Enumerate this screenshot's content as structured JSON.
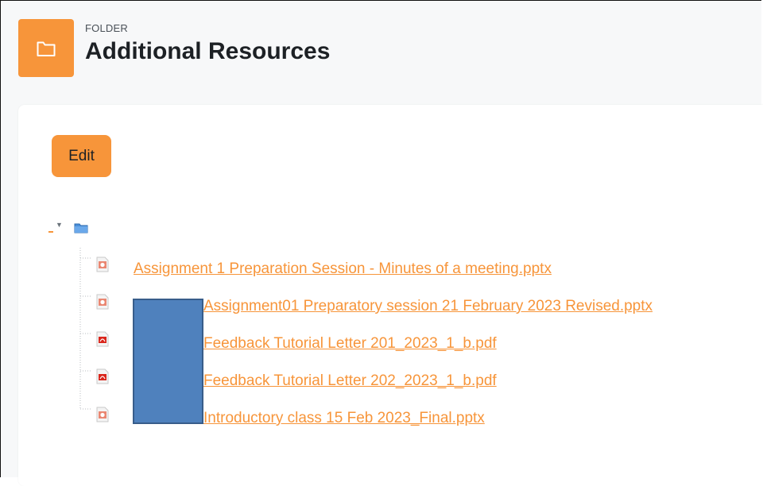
{
  "header": {
    "kicker": "FOLDER",
    "title": "Additional Resources",
    "icon": "folder-icon"
  },
  "actions": {
    "edit_label": "Edit"
  },
  "tree": {
    "toggle_glyph": "▼",
    "root_icon": "folder-icon",
    "files": [
      {
        "name": "Assignment 1 Preparation Session - Minutes of a meeting.pptx",
        "type": "pptx",
        "icon": "powerpoint-icon"
      },
      {
        "name": "Assignment01 Preparatory session 21 February 2023 Revised.pptx",
        "type": "pptx",
        "icon": "powerpoint-icon"
      },
      {
        "name": "Feedback Tutorial Letter 201_2023_1_b.pdf",
        "type": "pdf",
        "icon": "pdf-icon"
      },
      {
        "name": "Feedback Tutorial Letter 202_2023_1_b.pdf",
        "type": "pdf",
        "icon": "pdf-icon"
      },
      {
        "name": "Introductory class 15 Feb 2023_Final.pptx",
        "type": "pptx",
        "icon": "powerpoint-icon"
      }
    ]
  },
  "colors": {
    "accent": "#f7953a",
    "redaction": "#4f81bd"
  }
}
